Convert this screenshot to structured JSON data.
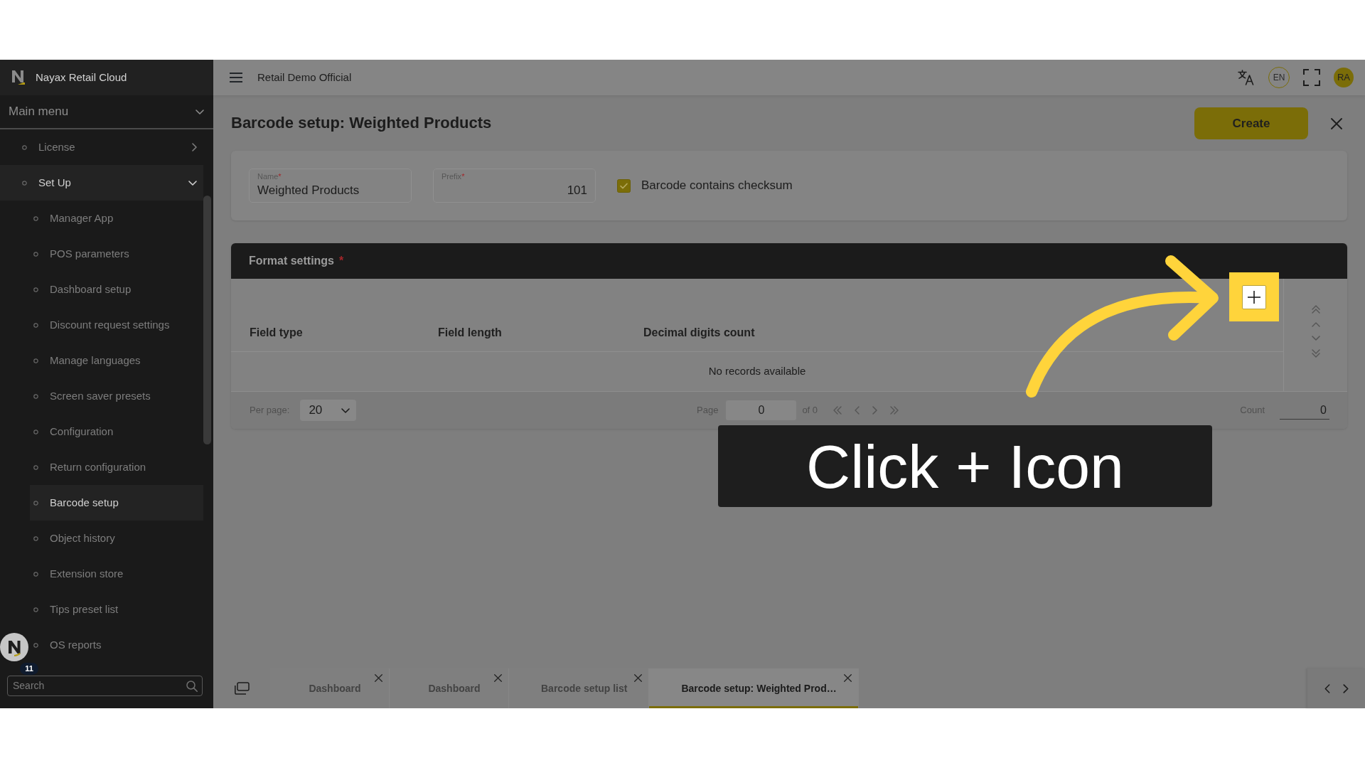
{
  "sidebar": {
    "brand": "Nayax Retail Cloud",
    "menu_title": "Main menu",
    "items": [
      {
        "label": "License",
        "expanded": false
      },
      {
        "label": "Set Up",
        "expanded": true,
        "children": [
          {
            "label": "Manager App",
            "selected": false
          },
          {
            "label": "POS parameters",
            "selected": false
          },
          {
            "label": "Dashboard setup",
            "selected": false
          },
          {
            "label": "Discount request settings",
            "selected": false
          },
          {
            "label": "Manage languages",
            "selected": false
          },
          {
            "label": "Screen saver presets",
            "selected": false
          },
          {
            "label": "Configuration",
            "selected": false
          },
          {
            "label": "Return configuration",
            "selected": false
          },
          {
            "label": "Barcode setup",
            "selected": true
          },
          {
            "label": "Object history",
            "selected": false
          },
          {
            "label": "Extension store",
            "selected": false
          },
          {
            "label": "Tips preset list",
            "selected": false
          },
          {
            "label": "OS reports",
            "selected": false
          }
        ]
      }
    ],
    "search": {
      "placeholder": "Search"
    }
  },
  "topbar": {
    "company": "Retail Demo Official",
    "language": "EN",
    "user_initials": "RA"
  },
  "page": {
    "title": "Barcode setup: Weighted Products",
    "create_button": "Create"
  },
  "form": {
    "fields": [
      {
        "label": "Name",
        "required_mark": "*",
        "value": "Weighted Products",
        "kind": "text"
      },
      {
        "label": "Prefix",
        "required_mark": "*",
        "value": "101",
        "kind": "number"
      }
    ],
    "checksum": {
      "label": "Barcode contains checksum",
      "checked": true
    }
  },
  "format_settings": {
    "title": "Format settings",
    "required_mark": "*",
    "columns": [
      "Field type",
      "Field length",
      "Decimal digits count"
    ],
    "empty_message": "No records available",
    "pager": {
      "per_page_label": "Per page:",
      "per_page": "20",
      "page_label": "Page",
      "page": "0",
      "page_total": "of 0",
      "count_label": "Count",
      "count": "0"
    }
  },
  "open_tabs": [
    {
      "label": "Dashboard",
      "selected": false
    },
    {
      "label": "Dashboard",
      "selected": false
    },
    {
      "label": "Barcode setup list",
      "selected": false
    },
    {
      "label": "Barcode setup: Weighted Prod…",
      "selected": true
    }
  ],
  "assistant": {
    "notification_count": "11"
  },
  "tutorial": {
    "caption": "Click + Icon"
  }
}
